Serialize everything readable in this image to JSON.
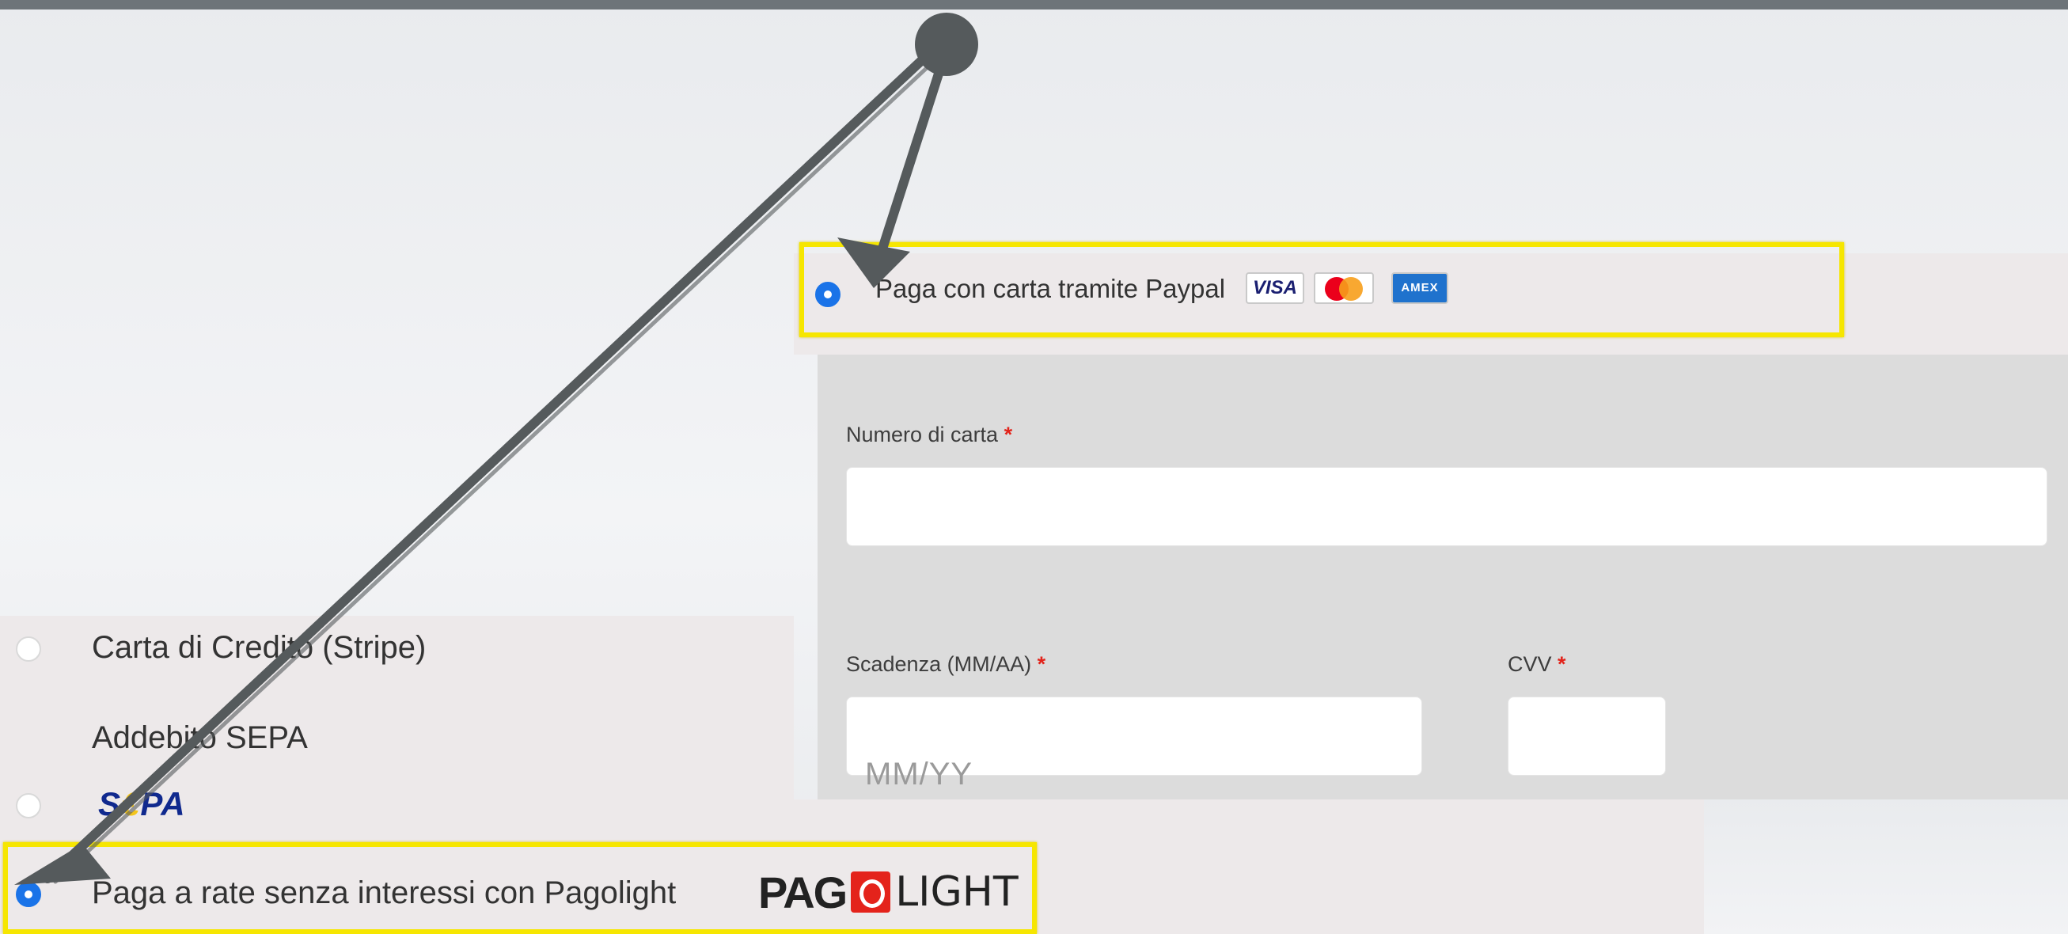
{
  "payment_options": {
    "stripe": {
      "label": "Carta di Credito (Stripe)",
      "selected": false
    },
    "sepa": {
      "label": "Addebito SEPA",
      "logo_text": "SEPA",
      "selected": false
    },
    "pagolight": {
      "label": "Paga a rate senza interessi con Pagolight",
      "logo_text": "PAGOLIGHT",
      "selected": true
    },
    "paypal": {
      "label": "Paga con carta tramite Paypal",
      "selected": true,
      "card_icons": [
        "visa-icon",
        "mastercard-icon",
        "amex-icon"
      ]
    }
  },
  "card_badges": {
    "visa": "VISA",
    "amex": "AMEX"
  },
  "card_form": {
    "card_number_label": "Numero di carta",
    "expiry_label": "Scadenza (MM/AA)",
    "expiry_placeholder": "MM/YY",
    "cvv_label": "CVV",
    "required_mark": "*"
  },
  "colors": {
    "radio_selected": "#1a73e8",
    "highlight": "#f6e600",
    "required": "#e2231a",
    "arrow": "#555a5c"
  }
}
